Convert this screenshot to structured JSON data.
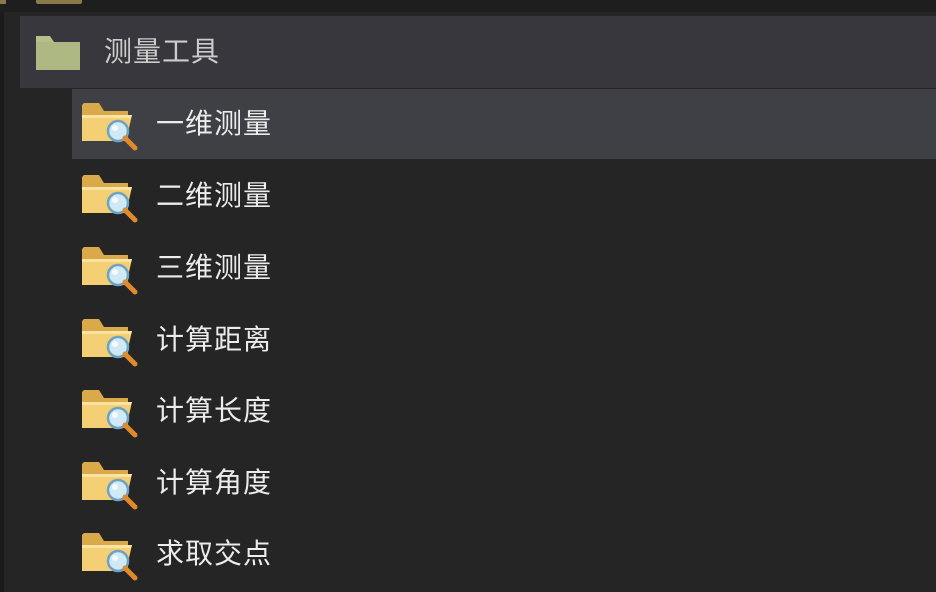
{
  "tree": {
    "group": {
      "label": "测量工具",
      "icon": "folder-icon",
      "icon_color": "#b7c08a"
    },
    "items": [
      {
        "label": "一维测量",
        "icon": "folder-search-icon",
        "selected": true
      },
      {
        "label": "二维测量",
        "icon": "folder-search-icon",
        "selected": false
      },
      {
        "label": "三维测量",
        "icon": "folder-search-icon",
        "selected": false
      },
      {
        "label": "计算距离",
        "icon": "folder-search-icon",
        "selected": false
      },
      {
        "label": "计算长度",
        "icon": "folder-search-icon",
        "selected": false
      },
      {
        "label": "计算角度",
        "icon": "folder-search-icon",
        "selected": false
      },
      {
        "label": "求取交点",
        "icon": "folder-search-icon",
        "selected": false
      }
    ]
  },
  "colors": {
    "background": "#252526",
    "group_highlight": "#37373d",
    "selected_highlight": "#3f3f46",
    "folder": "#f2c96a",
    "text": "#ececec"
  }
}
